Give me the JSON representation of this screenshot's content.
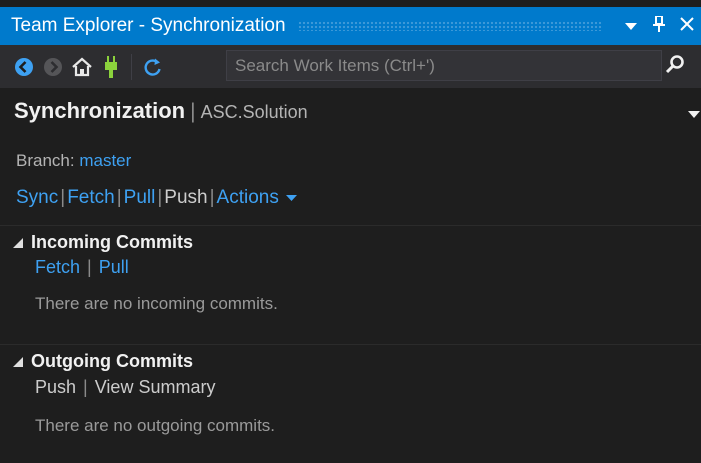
{
  "window": {
    "title": "Team Explorer - Synchronization",
    "controls": {
      "dropdown_icon": "dropdown-arrow-icon",
      "pin_icon": "pin-icon",
      "close_icon": "close-icon"
    }
  },
  "toolbar": {
    "buttons": [
      {
        "name": "back-icon",
        "enabled": true
      },
      {
        "name": "forward-icon",
        "enabled": false
      },
      {
        "name": "home-icon",
        "enabled": true
      },
      {
        "name": "connect-plug-icon",
        "enabled": true
      },
      {
        "name": "refresh-icon",
        "enabled": true
      }
    ],
    "search": {
      "placeholder": "Search Work Items (Ctrl+')",
      "value": ""
    }
  },
  "page": {
    "title": "Synchronization",
    "subtitle": "ASC.Solution"
  },
  "branch": {
    "label": "Branch:",
    "name": "master"
  },
  "actions": {
    "sync": "Sync",
    "fetch": "Fetch",
    "pull": "Pull",
    "push": "Push",
    "actions_menu": "Actions"
  },
  "incoming": {
    "title": "Incoming Commits",
    "fetch": "Fetch",
    "pull": "Pull",
    "message": "There are no incoming commits."
  },
  "outgoing": {
    "title": "Outgoing Commits",
    "push": "Push",
    "view_summary": "View Summary",
    "message": "There are no outgoing commits."
  },
  "colors": {
    "accent": "#007acc",
    "link": "#3ea1f2",
    "background": "#1e1e1e",
    "toolbar": "#2d2d30"
  }
}
